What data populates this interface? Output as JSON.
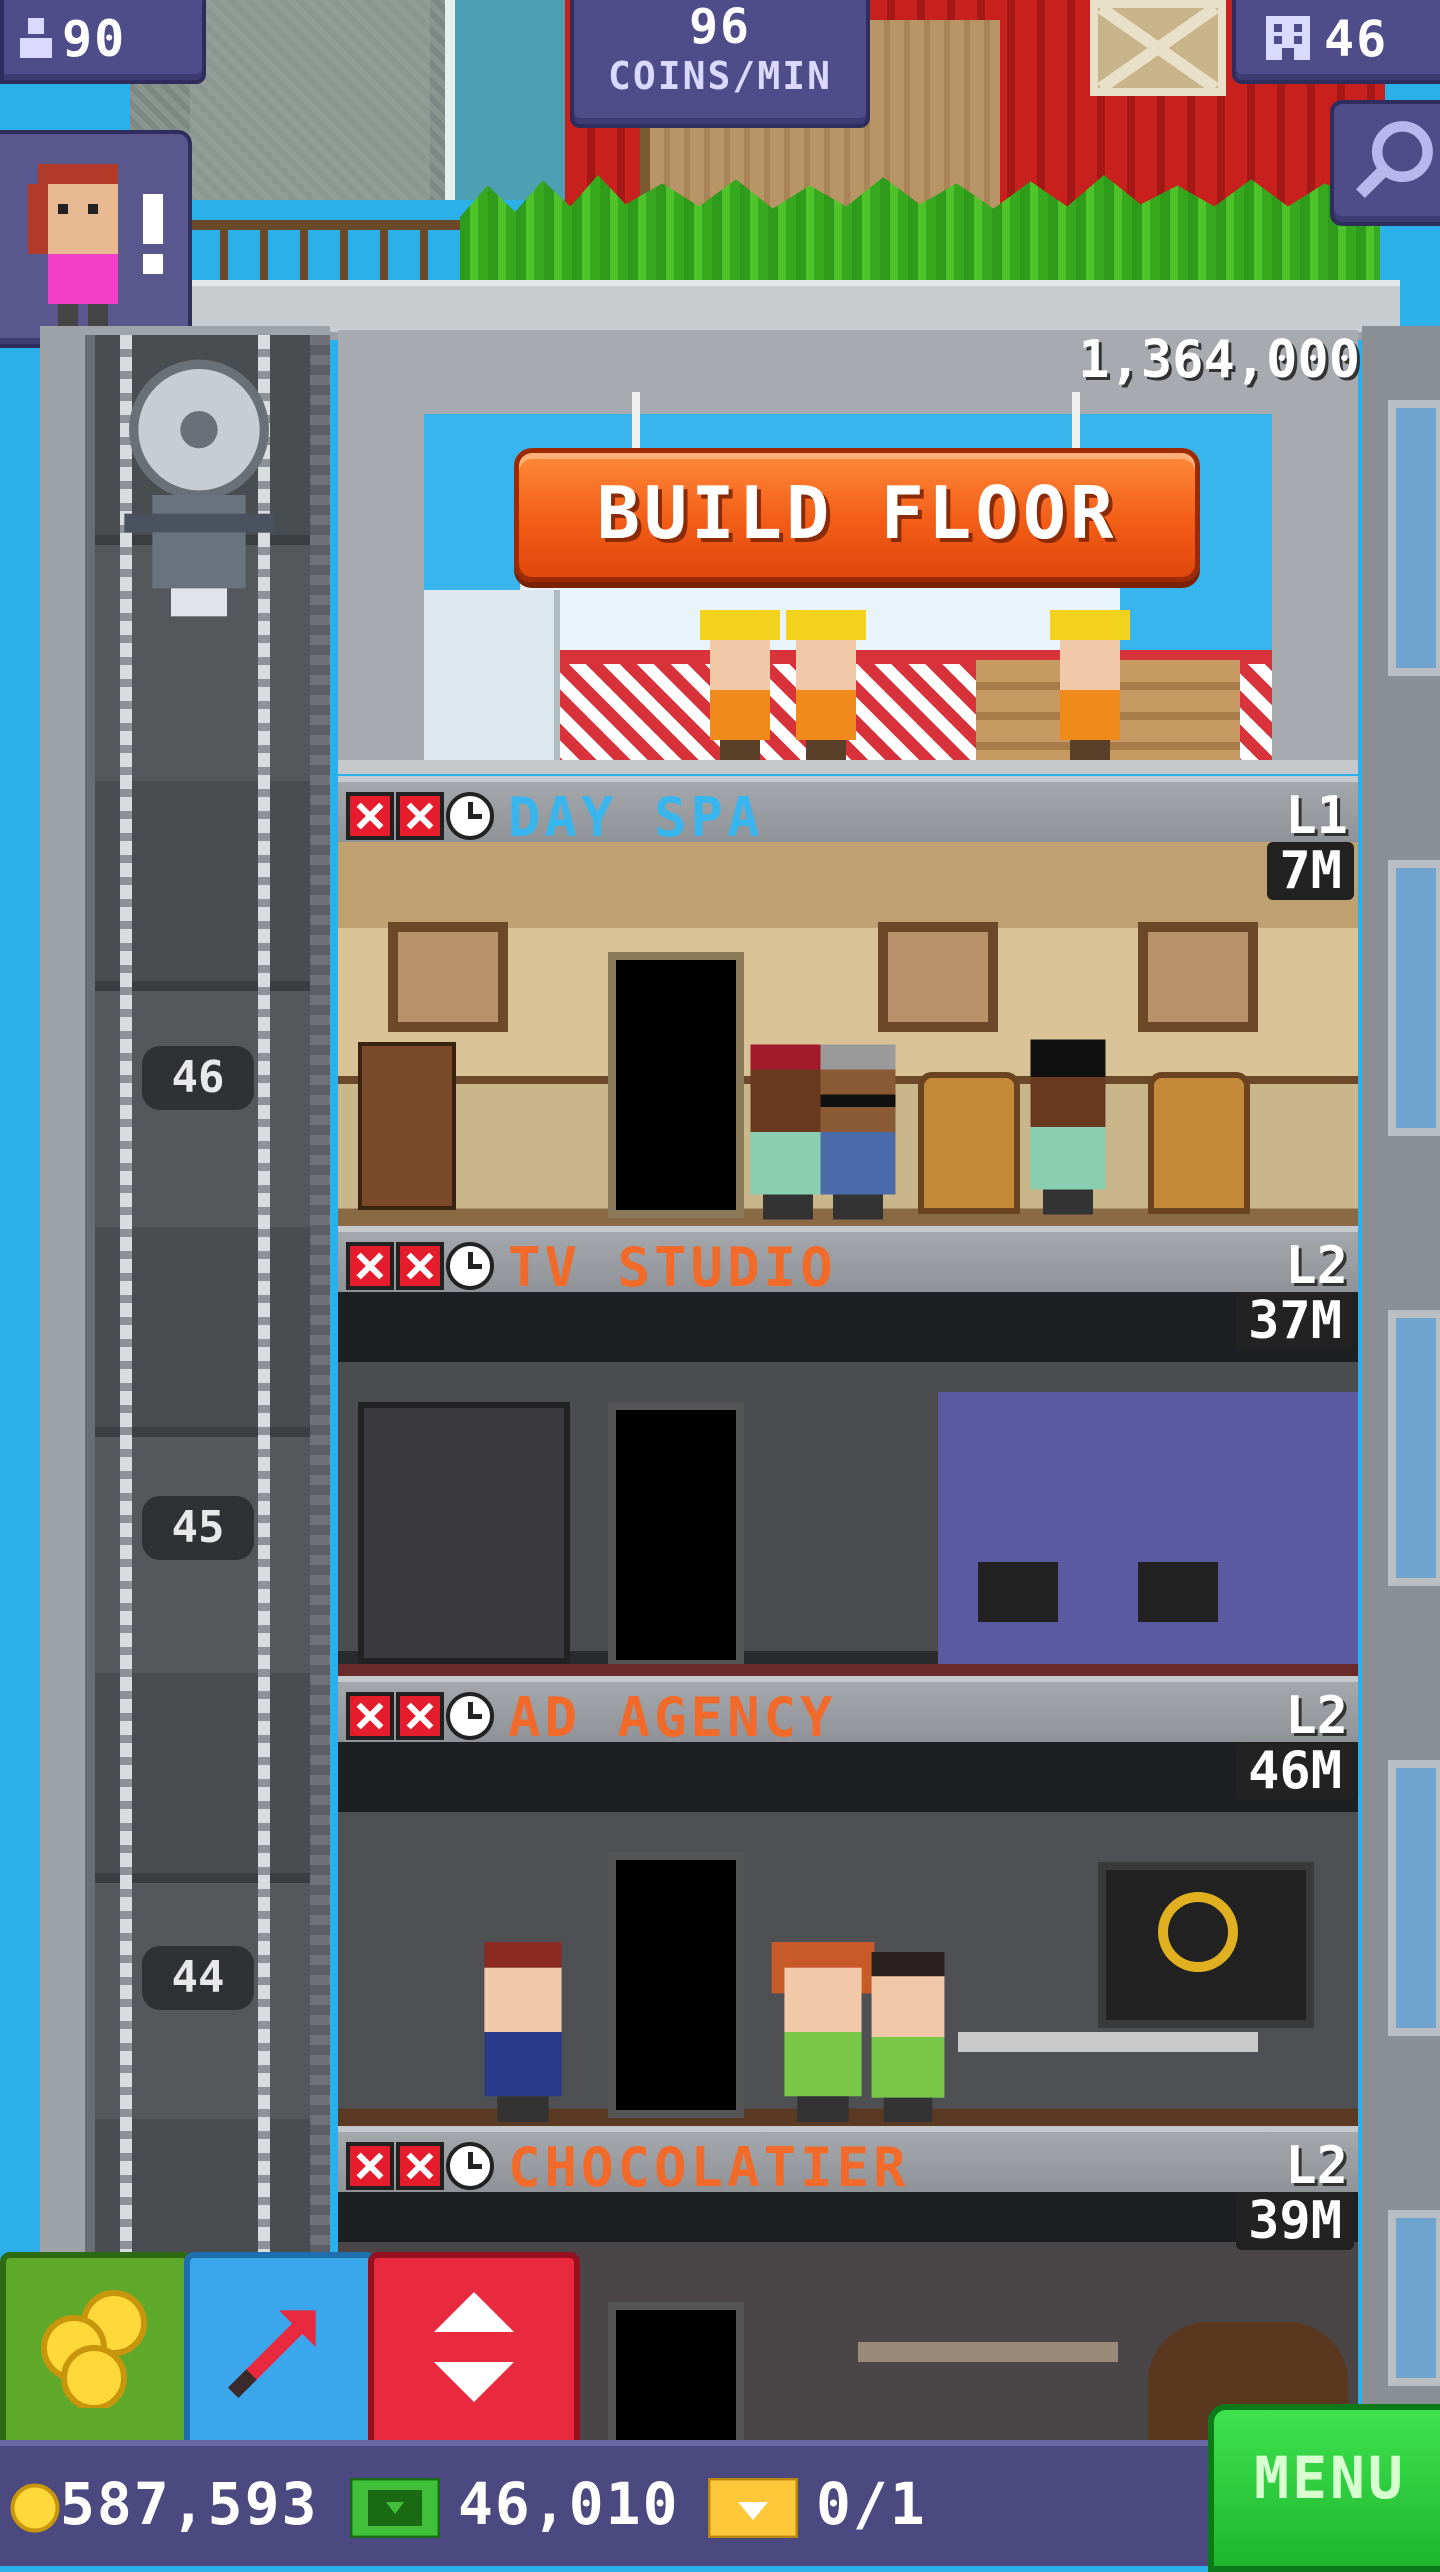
{
  "hud": {
    "population": "90",
    "coins_per_min_value": "96",
    "coins_per_min_label": "COINS/MIN",
    "floors_count": "46"
  },
  "build": {
    "price": "1,364,000",
    "button_label": "BUILD FLOOR"
  },
  "elevator": {
    "floor_markers": [
      "46",
      "45",
      "44"
    ]
  },
  "floors": [
    {
      "name": "DAY SPA",
      "level": "L1",
      "price": "7M",
      "name_color": "#39b5ee"
    },
    {
      "name": "TV STUDIO",
      "level": "L2",
      "price": "37M",
      "name_color": "#f26a2a"
    },
    {
      "name": "AD AGENCY",
      "level": "L2",
      "price": "46M",
      "name_color": "#f26a2a"
    },
    {
      "name": "CHOCOLATIER",
      "level": "L2",
      "price": "39M",
      "name_color": "#f26a2a"
    }
  ],
  "status": {
    "coins": "587,593",
    "bux": "46,010",
    "tickets": "0/1",
    "menu_label": "MENU"
  },
  "colors": {
    "hud": "#4e4c89",
    "build_button": "#f25d16",
    "menu": "#1eb62d",
    "elevator_button": "#e8293e",
    "raise_button": "#3aa6ec",
    "coins_button": "#5fa92a"
  },
  "icons": [
    "person-icon",
    "building-icon",
    "magnifier-icon",
    "coin-icon",
    "bux-icon",
    "ticket-icon",
    "arrow-icon",
    "up-down-icon",
    "x-icon",
    "clock-icon"
  ]
}
